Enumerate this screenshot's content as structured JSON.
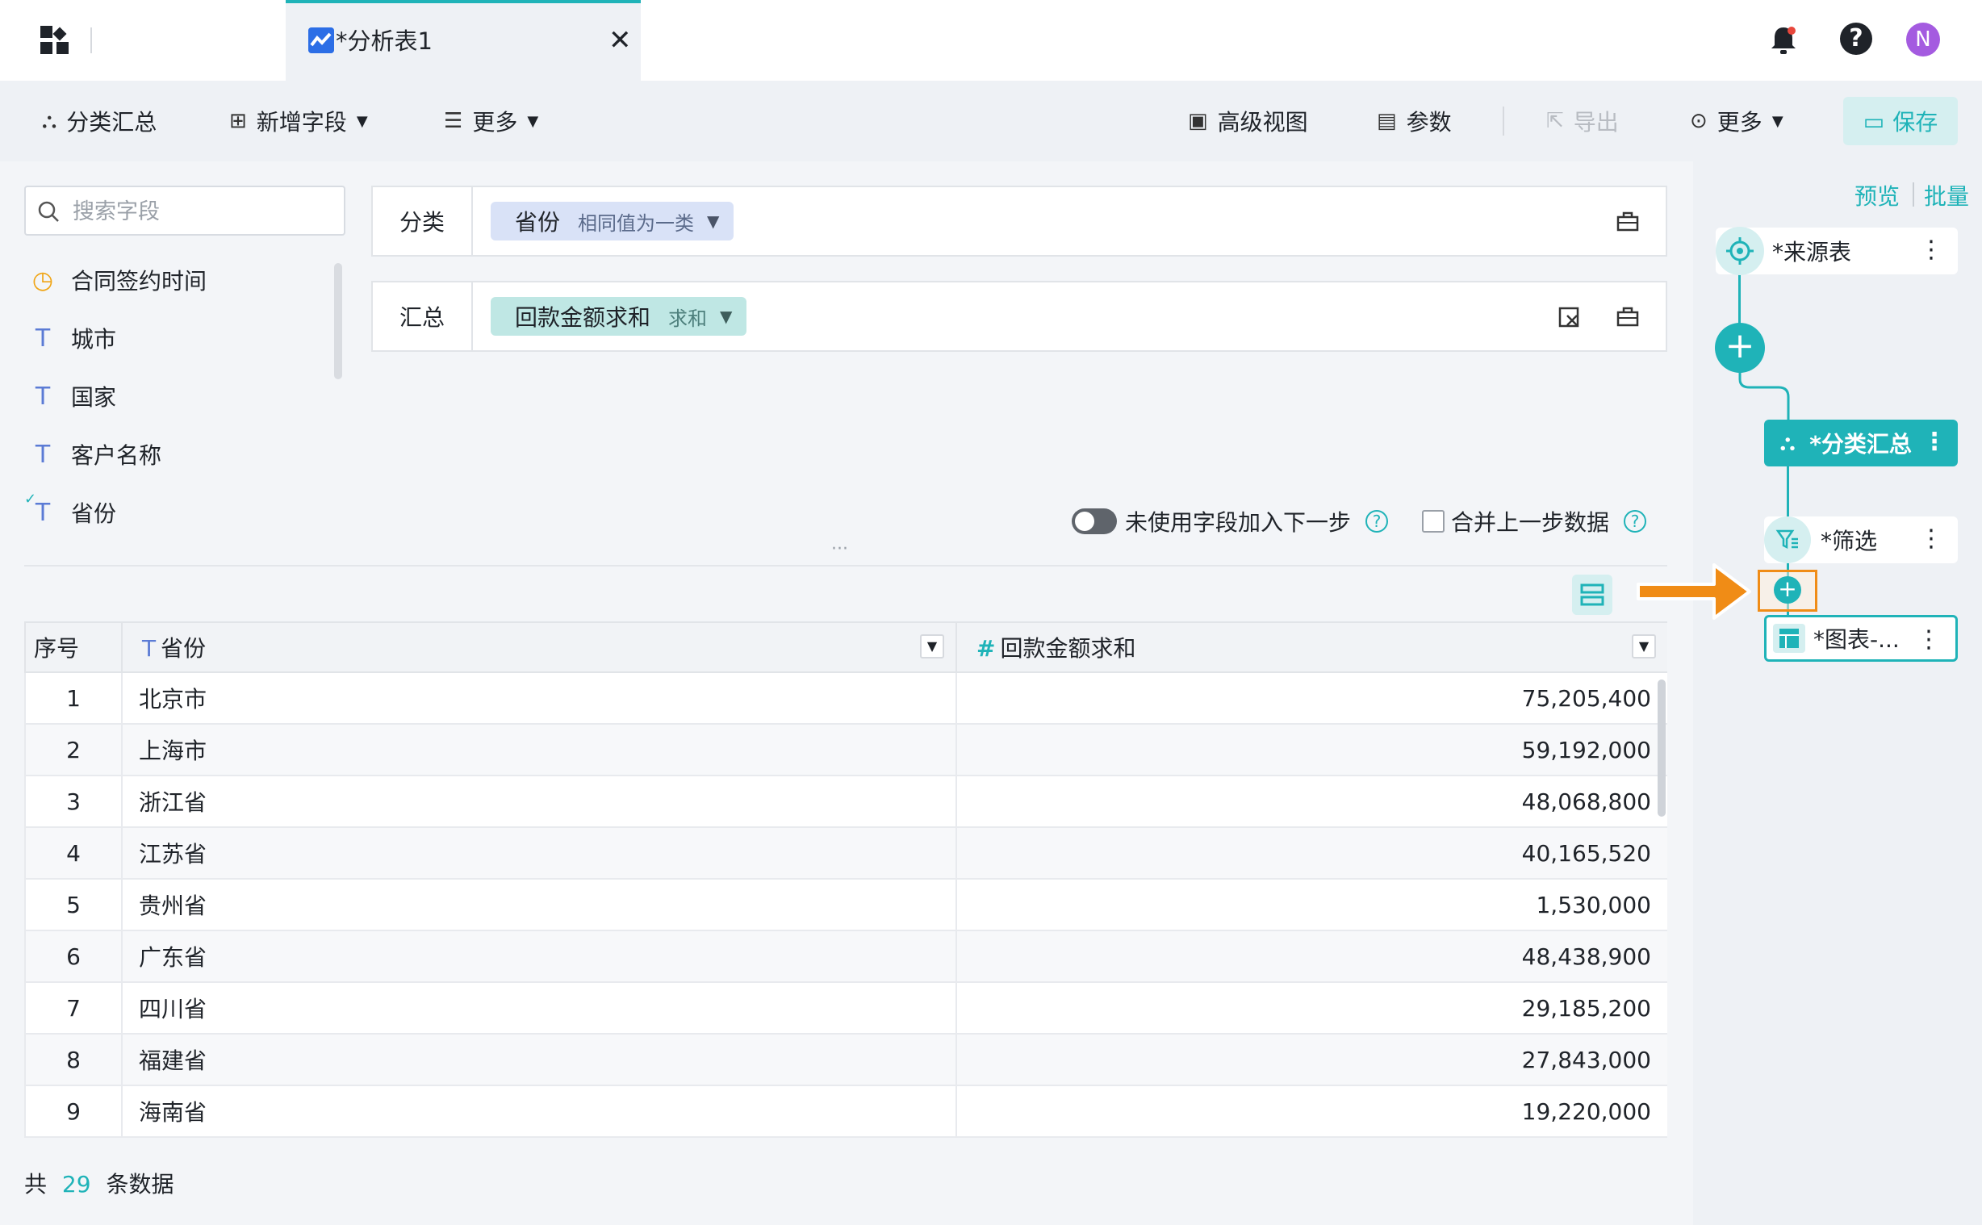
{
  "tab": {
    "title": "*分析表1"
  },
  "header": {
    "avatar_letter": "N"
  },
  "toolbar": {
    "group_summary": "分类汇总",
    "add_field": "新增字段",
    "more_left": "更多",
    "advanced_view": "高级视图",
    "params": "参数",
    "export": "导出",
    "more_right": "更多",
    "save": "保存"
  },
  "search": {
    "placeholder": "搜索字段"
  },
  "fields": [
    {
      "type": "time",
      "name": "合同签约时间"
    },
    {
      "type": "text",
      "name": "城市"
    },
    {
      "type": "text",
      "name": "国家"
    },
    {
      "type": "text",
      "name": "客户名称"
    },
    {
      "type": "text-checked",
      "name": "省份"
    }
  ],
  "classify": {
    "label": "分类",
    "chip": {
      "name": "省份",
      "sub": "相同值为一类"
    }
  },
  "summary": {
    "label": "汇总",
    "chip": {
      "name": "回款金额求和",
      "sub": "求和"
    }
  },
  "options": {
    "unused_fields": "未使用字段加入下一步",
    "merge_prev": "合并上一步数据"
  },
  "table": {
    "headers": [
      "序号",
      "省份",
      "回款金额求和"
    ],
    "rows": [
      [
        "1",
        "北京市",
        "75,205,400"
      ],
      [
        "2",
        "上海市",
        "59,192,000"
      ],
      [
        "3",
        "浙江省",
        "48,068,800"
      ],
      [
        "4",
        "江苏省",
        "40,165,520"
      ],
      [
        "5",
        "贵州省",
        "1,530,000"
      ],
      [
        "6",
        "广东省",
        "48,438,900"
      ],
      [
        "7",
        "四川省",
        "29,185,200"
      ],
      [
        "8",
        "福建省",
        "27,843,000"
      ],
      [
        "9",
        "海南省",
        "19,220,000"
      ]
    ]
  },
  "footer": {
    "prefix": "共",
    "count": "29",
    "suffix": "条数据"
  },
  "right_panel": {
    "preview": "预览",
    "batch": "批量",
    "nodes": {
      "source": "*来源表",
      "group": "*分类汇总",
      "filter": "*筛选",
      "chart": "*图表-..."
    }
  },
  "colors": {
    "accent": "#1fb3b8",
    "highlight": "#f08c16",
    "avatar": "#a45be0"
  }
}
